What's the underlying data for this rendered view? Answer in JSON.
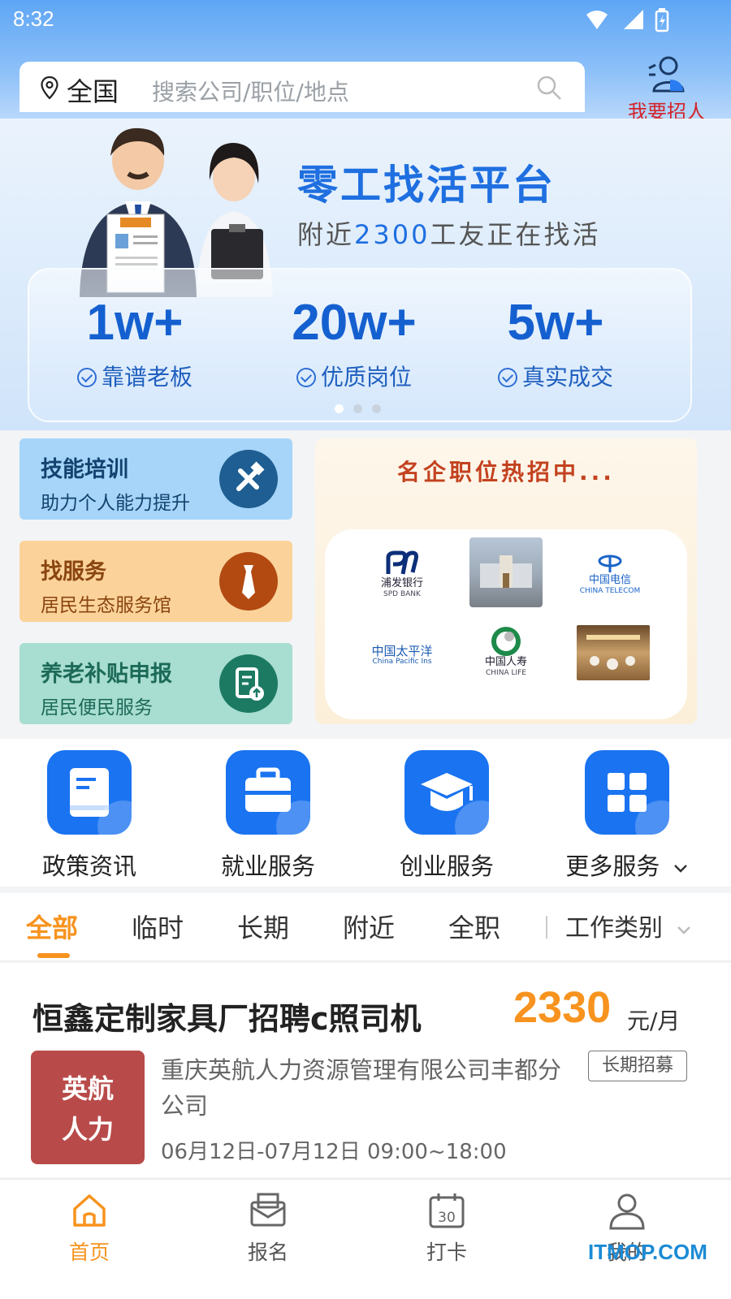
{
  "status_bar": {
    "time": "8:32"
  },
  "header": {
    "location": "全国",
    "search_placeholder": "搜索公司/职位/地点",
    "recruit_label": "我要招人"
  },
  "banner": {
    "title": "零工找活平台",
    "subtitle_prefix": "附近",
    "subtitle_number": "2300",
    "subtitle_suffix": "工友正在找活",
    "stats": [
      {
        "value": "1w+",
        "label": "靠谱老板"
      },
      {
        "value": "20w+",
        "label": "优质岗位"
      },
      {
        "value": "5w+",
        "label": "真实成交"
      }
    ],
    "page_index": 1,
    "page_count": 3
  },
  "service_cards": [
    {
      "title": "技能培训",
      "subtitle": "助力个人能力提升",
      "icon": "tools-icon"
    },
    {
      "title": "找服务",
      "subtitle": "居民生态服务馆",
      "icon": "tie-icon"
    },
    {
      "title": "养老补贴申报",
      "subtitle": "居民便民服务",
      "icon": "document-upload-icon"
    }
  ],
  "famous": {
    "title": "名企职位热招中...",
    "logos": [
      {
        "name": "浦发银行",
        "english": "SPD BANK"
      },
      {
        "name": "",
        "english": ""
      },
      {
        "name": "中国电信",
        "english": "CHINA TELECOM"
      },
      {
        "name": "中国太平洋",
        "english": "China Pacific Ins"
      },
      {
        "name": "中国人寿",
        "english": "CHINA LIFE"
      },
      {
        "name": "",
        "english": ""
      }
    ]
  },
  "quick_services": [
    {
      "label": "政策资讯",
      "icon": "book-icon"
    },
    {
      "label": "就业服务",
      "icon": "briefcase-icon"
    },
    {
      "label": "创业服务",
      "icon": "graduation-cap-icon"
    },
    {
      "label": "更多服务",
      "icon": "grid-icon"
    }
  ],
  "tabs": [
    "全部",
    "临时",
    "长期",
    "附近",
    "全职"
  ],
  "tab_filter": "工作类别",
  "job": {
    "title": "恒鑫定制家具厂招聘c照司机",
    "salary": "2330",
    "salary_unit": "元/月",
    "logo_line1": "英航",
    "logo_line2": "人力",
    "company": "重庆英航人力资源管理有限公司丰都分公司",
    "tag": "长期招募",
    "date_range": "06月12日-07月12日 09:00~18:00"
  },
  "bottom_nav": [
    {
      "label": "首页",
      "icon": "home-icon",
      "active": true
    },
    {
      "label": "报名",
      "icon": "mail-icon",
      "active": false
    },
    {
      "label": "打卡",
      "icon": "calendar-icon",
      "active": false
    },
    {
      "label": "我的",
      "icon": "user-icon",
      "active": false
    }
  ],
  "watermark": "ITMOP.COM",
  "colors": {
    "primary": "#1a73f0",
    "accent": "#f7931e",
    "banner_blue": "#1f6fe0"
  }
}
